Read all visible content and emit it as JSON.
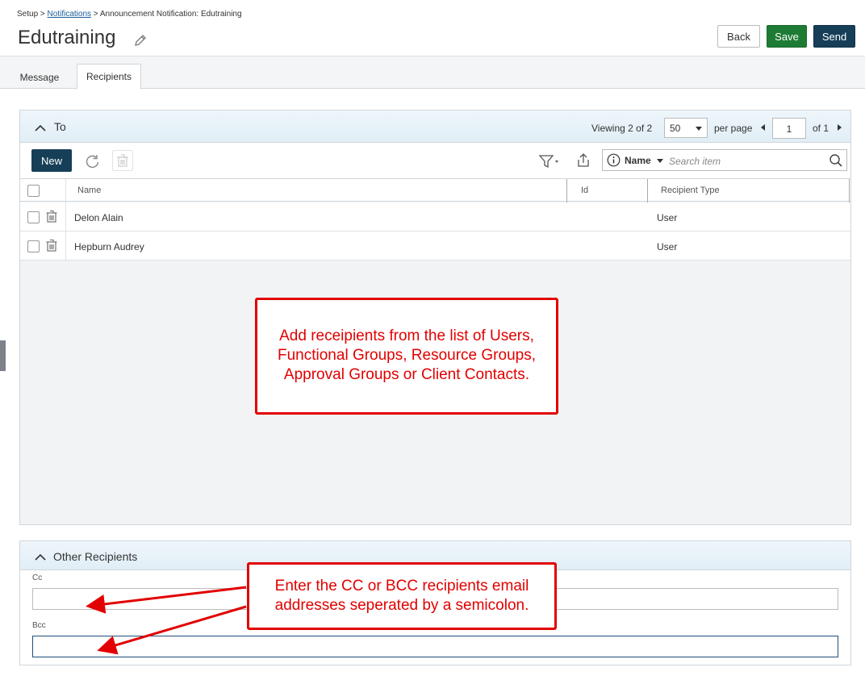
{
  "breadcrumb": {
    "setup": "Setup",
    "sep1": ">",
    "notifications": "Notifications",
    "sep2": ">",
    "current": "Announcement Notification: Edutraining"
  },
  "page": {
    "title": "Edutraining",
    "edit_icon": "pencil-icon"
  },
  "actions": {
    "back": "Back",
    "save": "Save",
    "send": "Send",
    "save_color": "#1e7b34",
    "send_color": "#163f57"
  },
  "tabs": [
    {
      "label": "Message",
      "active": false
    },
    {
      "label": "Recipients",
      "active": true
    }
  ],
  "to_panel": {
    "title": "To",
    "viewing_label": "Viewing",
    "viewing_count": "2 of 2",
    "per_page_value": "50",
    "per_page_label": "per page",
    "page_number": "1",
    "page_of": "of 1",
    "new_button": "New",
    "search": {
      "field": "Name",
      "placeholder": "Search item"
    },
    "columns": [
      "Name",
      "Id",
      "Recipient Type"
    ],
    "rows": [
      {
        "name": "Delon Alain",
        "id": "",
        "type": "User"
      },
      {
        "name": "Hepburn Audrey",
        "id": "",
        "type": "User"
      }
    ]
  },
  "other_panel": {
    "title": "Other Recipients",
    "cc_label": "Cc",
    "cc_value": "",
    "bcc_label": "Bcc",
    "bcc_value": ""
  },
  "callouts": {
    "recipients_line1": "Add receipients from the list of Users,",
    "recipients_line2": "Functional Groups, Resource Groups,",
    "recipients_line3": "Approval Groups or Client Contacts.",
    "cc_line1": "Enter the CC or BCC recipients email",
    "cc_line2": "addresses seperated by a semicolon.",
    "color": "#e20000"
  }
}
